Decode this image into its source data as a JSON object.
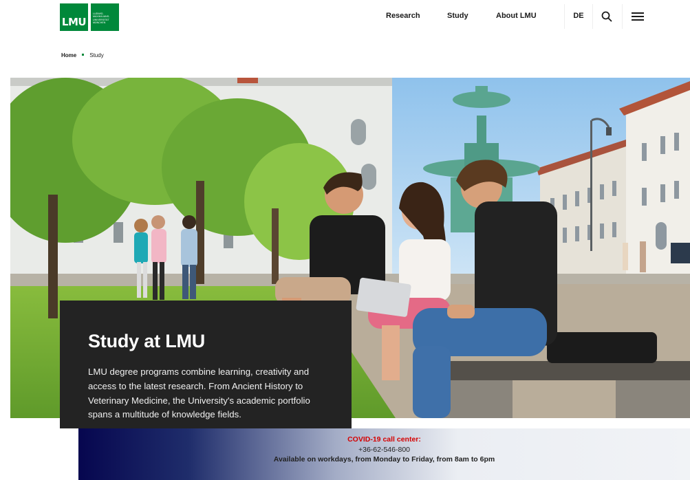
{
  "logo": {
    "main_text": "LMU",
    "side_lines": [
      "Ludwig-",
      "Maximilians-",
      "Universität",
      "München"
    ]
  },
  "nav": {
    "items": [
      "Research",
      "Study",
      "About LMU"
    ],
    "language": "DE",
    "search_icon": "search-icon",
    "menu_icon": "hamburger-menu-icon"
  },
  "breadcrumb": {
    "home": "Home",
    "current": "Study"
  },
  "hero": {
    "title": "Study at LMU",
    "text": "LMU degree programs combine learning, creativity and access to the latest research. From Ancient History to Veterinary Medicine, the University's academic portfolio spans a multitude of knowledge fields."
  },
  "covid": {
    "title": "COVID-19 call center:",
    "phone": "+36-62-546-800",
    "hours": "Available on workdays, from Monday to Friday, from 8am to 6pm"
  },
  "colors": {
    "brand_green": "#00883a",
    "card_bg": "#232323",
    "covid_red": "#d50000"
  }
}
